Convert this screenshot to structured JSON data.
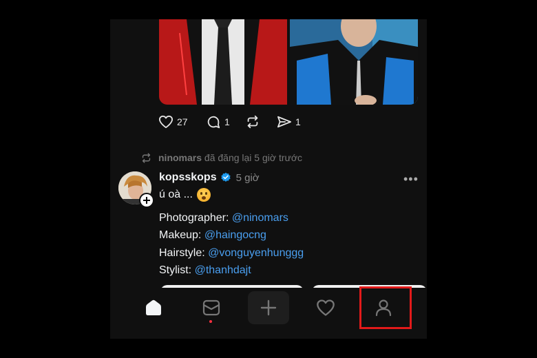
{
  "previous_post": {
    "likes": "27",
    "replies": "1",
    "shares": "1"
  },
  "repost_notice": {
    "user": "ninomars",
    "text": "đã đăng lại 5 giờ trước"
  },
  "post": {
    "username": "kopsskops",
    "time": "5 giờ",
    "text": "ú oà ...",
    "more": "•••",
    "credits": [
      {
        "role": "Photographer:",
        "mention": "@ninomars"
      },
      {
        "role": "Makeup:",
        "mention": "@haingocng"
      },
      {
        "role": "Hairstyle:",
        "mention": "@vonguyenhunggg"
      },
      {
        "role": "Stylist:",
        "mention": "@thanhdajt"
      }
    ]
  },
  "nav": {
    "items": [
      "home-icon",
      "inbox-icon",
      "plus-icon",
      "heart-icon",
      "profile-icon"
    ],
    "active": "profile",
    "highlight_color": "#e21a1a"
  },
  "colors": {
    "background": "#101010",
    "mention": "#4a9ff0",
    "verified": "#1d9bf0",
    "notification_dot": "#ff3040"
  }
}
